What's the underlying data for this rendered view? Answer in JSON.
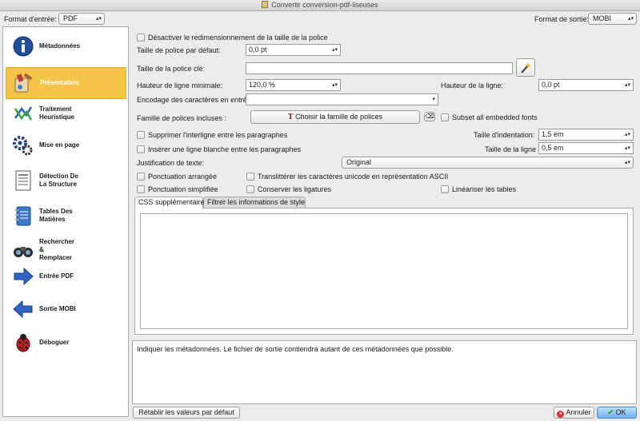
{
  "window": {
    "title": "Convertir conversion-pdf-liseuses"
  },
  "header": {
    "input_format_label": "Format d'entrée:",
    "input_format_value": "PDF",
    "output_format_label": "Format de sortie:",
    "output_format_value": "MOBI"
  },
  "sidebar": {
    "items": [
      {
        "label": "Métadonnées",
        "icon": "info-icon"
      },
      {
        "label": "Présentation",
        "icon": "paint-brush-icon"
      },
      {
        "label": "Traitement\nHeuristique",
        "icon": "heuristic-arrows-icon"
      },
      {
        "label": "Mise en page",
        "icon": "gears-icon"
      },
      {
        "label": "Détection De\nLa Structure",
        "icon": "document-structure-icon"
      },
      {
        "label": "Tables Des\nMatières",
        "icon": "notebook-icon"
      },
      {
        "label": "Rechercher\n&\nRemplacer",
        "icon": "binoculars-icon"
      },
      {
        "label": "Entrée PDF",
        "icon": "arrow-right-icon"
      },
      {
        "label": "Sortie MOBI",
        "icon": "arrow-left-icon"
      },
      {
        "label": "Déboguer",
        "icon": "ladybug-icon"
      }
    ],
    "active_index": 1
  },
  "form": {
    "disable_resize_label": "Désactiver le redimensionnement de la taille de la police",
    "default_font_size_label": "Taille de police par défaut:",
    "default_font_size_value": "0,0 pt",
    "key_font_size_label": "Taille de la police clé:",
    "key_font_size_value": "",
    "min_line_height_label": "Hauteur de ligne minimale:",
    "min_line_height_value": "120,0 %",
    "line_height_label": "Hauteur de la ligne:",
    "line_height_value": "0,0 pt",
    "input_encoding_label": "Encodage des caractères en entrée:",
    "input_encoding_value": "",
    "embedded_font_label": "Famille de polices incluses :",
    "choose_font_button": "Choisir la famille de polices",
    "subset_fonts_label": "Subset all embedded fonts",
    "remove_spacing_label": "Supprimer l'interligne entre les paragraphes",
    "indent_size_label": "Taille d'indentation:",
    "indent_size_value": "1,5 em",
    "insert_blank_line_label": "Insérer une ligne blanche entre les paragraphes",
    "blank_line_size_label": "Taille de la ligne",
    "blank_line_size_value": "0,5 em",
    "justification_label": "Justification de texte:",
    "justification_value": "Original",
    "smarten_punct_label": "Ponctuation arrangée",
    "transliterate_label": "Translittérer les caractères unicode en représentation ASCII",
    "unsmarten_punct_label": "Ponctuation simplifiée",
    "keep_ligatures_label": "Conserver les ligatures",
    "linearize_tables_label": "Linéariser les tables"
  },
  "tabs": [
    {
      "label": "CSS supplémentaire"
    },
    {
      "label": "Filtrer les informations de style"
    }
  ],
  "help_text": "Indiquer les métadonnées. Le fichier de sortie contiendra autant de ces métadonnées que possible.",
  "footer": {
    "reset_button": "Rétablir les valeurs par défaut",
    "cancel_button": "Annuler",
    "ok_button": "OK"
  },
  "colors": {
    "active_item": "#f4c44a",
    "window_bg": "#ececec"
  }
}
